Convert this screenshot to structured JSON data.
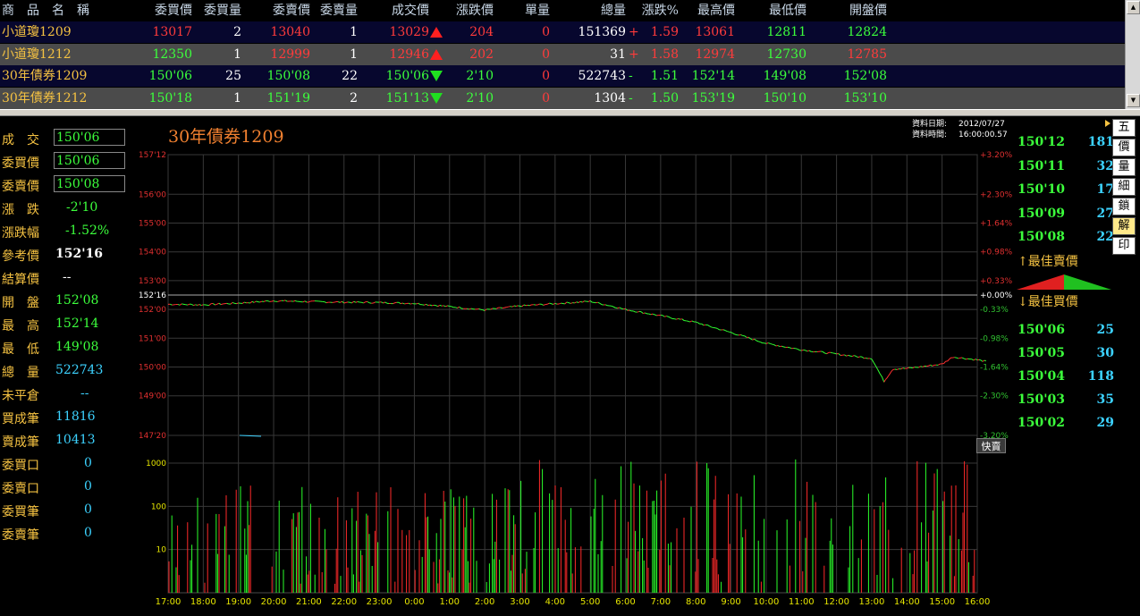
{
  "quote_table": {
    "headers": [
      "商　品　名　稱",
      "委買價",
      "委買量",
      "委賣價",
      "委賣量",
      "成交價",
      "漲跌價",
      "單量",
      "總量",
      "漲跌%",
      "最高價",
      "最低價",
      "開盤價"
    ],
    "rows": [
      {
        "name": "小道瓊1209",
        "bid": "13017",
        "bid_vol": "2",
        "ask": "13040",
        "ask_vol": "1",
        "last": "13029",
        "dir": "up",
        "change": "204",
        "unit_vol": "0",
        "total_vol": "151369",
        "pct_sign": "+",
        "pct": "1.59",
        "high": "13061",
        "low": "12811",
        "open": "12824",
        "name_color": "#f5c242",
        "bid_color": "#ff3b3b",
        "ask_color": "#ff3b3b",
        "last_color": "#ff3b3b",
        "change_color": "#ff3b3b",
        "pct_color": "#ff3b3b",
        "high_color": "#ff3b3b",
        "low_color": "#3cff3c",
        "open_color": "#3cff3c",
        "bg": "#07072e"
      },
      {
        "name": "小道瓊1212",
        "bid": "12350",
        "bid_vol": "1",
        "ask": "12999",
        "ask_vol": "1",
        "last": "12946",
        "dir": "up",
        "change": "202",
        "unit_vol": "0",
        "total_vol": "31",
        "pct_sign": "+",
        "pct": "1.58",
        "high": "12974",
        "low": "12730",
        "open": "12785",
        "name_color": "#f5c242",
        "bid_color": "#3cff3c",
        "ask_color": "#ff3b3b",
        "last_color": "#ff3b3b",
        "change_color": "#ff3b3b",
        "pct_color": "#ff3b3b",
        "high_color": "#ff3b3b",
        "low_color": "#3cff3c",
        "open_color": "#ff3b3b",
        "bg": "#4b4b4b"
      },
      {
        "name": "30年債券1209",
        "bid": "150'06",
        "bid_vol": "25",
        "ask": "150'08",
        "ask_vol": "22",
        "last": "150'06",
        "dir": "down",
        "change": "2'10",
        "unit_vol": "0",
        "total_vol": "522743",
        "pct_sign": "-",
        "pct": "1.51",
        "high": "152'14",
        "low": "149'08",
        "open": "152'08",
        "name_color": "#f5c242",
        "bid_color": "#3cff3c",
        "ask_color": "#3cff3c",
        "last_color": "#3cff3c",
        "change_color": "#3cff3c",
        "pct_color": "#3cff3c",
        "high_color": "#3cff3c",
        "low_color": "#3cff3c",
        "open_color": "#3cff3c",
        "bg": "#07072e"
      },
      {
        "name": "30年債券1212",
        "bid": "150'18",
        "bid_vol": "1",
        "ask": "151'19",
        "ask_vol": "2",
        "last": "151'13",
        "dir": "down",
        "change": "2'10",
        "unit_vol": "0",
        "total_vol": "1304",
        "pct_sign": "-",
        "pct": "1.50",
        "high": "153'19",
        "low": "150'10",
        "open": "153'10",
        "name_color": "#f5c242",
        "bid_color": "#3cff3c",
        "ask_color": "#3cff3c",
        "last_color": "#3cff3c",
        "change_color": "#3cff3c",
        "pct_color": "#3cff3c",
        "high_color": "#3cff3c",
        "low_color": "#3cff3c",
        "open_color": "#3cff3c",
        "bg": "#4b4b4b"
      }
    ]
  },
  "left_panel": {
    "items": [
      {
        "label": "成　交",
        "value": "150'06",
        "color": "#3cff3c",
        "boxed": true
      },
      {
        "label": "委買價",
        "value": "150'06",
        "color": "#3cff3c",
        "boxed": true
      },
      {
        "label": "委賣價",
        "value": "150'08",
        "color": "#3cff3c",
        "boxed": true
      },
      {
        "label": "漲　跌",
        "value": "-2'10",
        "color": "#3cff3c",
        "boxed": false
      },
      {
        "label": "漲跌幅",
        "value": "-1.52%",
        "color": "#3cff3c",
        "boxed": false
      },
      {
        "label": "參考價",
        "value": "152'16",
        "color": "#ffffff",
        "boxed": false
      },
      {
        "label": "結算價",
        "value": "--",
        "color": "#ffffff",
        "boxed": false
      },
      {
        "label": "開　盤",
        "value": "152'08",
        "color": "#3cff3c",
        "boxed": false
      },
      {
        "label": "最　高",
        "value": "152'14",
        "color": "#3cff3c",
        "boxed": false
      },
      {
        "label": "最　低",
        "value": "149'08",
        "color": "#3cff3c",
        "boxed": false
      },
      {
        "label": "總　量",
        "value": "522743",
        "color": "#3cd2ff",
        "boxed": false
      },
      {
        "label": "未平倉",
        "value": "--",
        "color": "#3cd2ff",
        "boxed": false
      },
      {
        "label": "買成筆",
        "value": "11816",
        "color": "#3cd2ff",
        "boxed": false
      },
      {
        "label": "賣成筆",
        "value": "10413",
        "color": "#3cd2ff",
        "boxed": false
      },
      {
        "label": "委買口",
        "value": "0",
        "color": "#3cd2ff",
        "boxed": false
      },
      {
        "label": "委賣口",
        "value": "0",
        "color": "#3cd2ff",
        "boxed": false
      },
      {
        "label": "委買筆",
        "value": "0",
        "color": "#3cd2ff",
        "boxed": false
      },
      {
        "label": "委賣筆",
        "value": "0",
        "color": "#3cd2ff",
        "boxed": false
      }
    ]
  },
  "chart_header": {
    "title": "30年債券1209",
    "date_label": "資料日期:",
    "date_value": "2012/07/27",
    "time_label": "資料時間:",
    "time_value": "16:00:00.57"
  },
  "chart_data": {
    "type": "line",
    "title": "30年債券1209",
    "reference_price": "152'16",
    "price_ticks": [
      "157'12",
      "156'00",
      "155'00",
      "154'00",
      "153'00",
      "152'16",
      "152'00",
      "151'00",
      "150'00",
      "149'00",
      "147'20"
    ],
    "price_tick_values": [
      157.375,
      156.0,
      155.0,
      154.0,
      153.0,
      152.5,
      152.0,
      151.0,
      150.0,
      149.0,
      147.625
    ],
    "pct_ticks": [
      "+3.20%",
      "+2.30%",
      "+1.64%",
      "+0.98%",
      "+0.33%",
      "+0.00%",
      "-0.33%",
      "-0.98%",
      "-1.64%",
      "-2.30%",
      "-3.20%"
    ],
    "ylim": [
      147.625,
      157.375
    ],
    "x": [
      "17:00",
      "18:00",
      "19:00",
      "20:00",
      "21:00",
      "22:00",
      "23:00",
      "0:00",
      "1:00",
      "2:00",
      "3:00",
      "4:00",
      "5:00",
      "6:00",
      "7:00",
      "8:00",
      "9:00",
      "10:00",
      "11:00",
      "12:00",
      "13:00",
      "14:00",
      "15:00",
      "16:00"
    ],
    "price_series": [
      {
        "t": 0,
        "p": 152.18
      },
      {
        "t": 1,
        "p": 152.16
      },
      {
        "t": 2,
        "p": 152.22
      },
      {
        "t": 3,
        "p": 152.3
      },
      {
        "t": 4,
        "p": 152.27
      },
      {
        "t": 5,
        "p": 152.25
      },
      {
        "t": 6,
        "p": 152.24
      },
      {
        "t": 7,
        "p": 152.21
      },
      {
        "t": 8,
        "p": 152.1
      },
      {
        "t": 9,
        "p": 151.98
      },
      {
        "t": 10,
        "p": 152.12
      },
      {
        "t": 11,
        "p": 152.2
      },
      {
        "t": 12,
        "p": 152.28
      },
      {
        "t": 12.6,
        "p": 152.12
      },
      {
        "t": 13,
        "p": 152.0
      },
      {
        "t": 14,
        "p": 151.78
      },
      {
        "t": 15,
        "p": 151.55
      },
      {
        "t": 16,
        "p": 151.2
      },
      {
        "t": 17,
        "p": 150.82
      },
      {
        "t": 18,
        "p": 150.6
      },
      {
        "t": 19,
        "p": 150.45
      },
      {
        "t": 20,
        "p": 150.3
      },
      {
        "t": 20.35,
        "p": 149.5
      },
      {
        "t": 20.6,
        "p": 149.93
      },
      {
        "t": 21,
        "p": 149.95
      },
      {
        "t": 22,
        "p": 150.1
      },
      {
        "t": 22.3,
        "p": 150.35
      },
      {
        "t": 23,
        "p": 150.25
      },
      {
        "t": 23.3,
        "p": 150.18
      }
    ],
    "volume_ticks": [
      "1000",
      "100",
      "10"
    ],
    "volume_tick_values": [
      1000,
      100,
      10
    ],
    "volume_ylim": [
      1,
      3000
    ],
    "volume_scale": "log",
    "grid": true
  },
  "right_panel": {
    "asks": [
      {
        "price": "150'12",
        "vol": "181"
      },
      {
        "price": "150'11",
        "vol": "32"
      },
      {
        "price": "150'10",
        "vol": "17"
      },
      {
        "price": "150'09",
        "vol": "27"
      },
      {
        "price": "150'08",
        "vol": "22"
      }
    ],
    "ask_label": "↑最佳賣價",
    "bid_label": "↓最佳買價",
    "bids": [
      {
        "price": "150'06",
        "vol": "25"
      },
      {
        "price": "150'05",
        "vol": "30"
      },
      {
        "price": "150'04",
        "vol": "118"
      },
      {
        "price": "150'03",
        "vol": "35"
      },
      {
        "price": "150'02",
        "vol": "29"
      }
    ]
  },
  "view_buttons": [
    "五",
    "價",
    "量",
    "細",
    "鎖",
    "解",
    "印"
  ],
  "fast_button": "快賣",
  "colors": {
    "up": "#ff3b3b",
    "down": "#3cff3c",
    "label": "#f5c242",
    "cyan": "#3cd2ff",
    "grid": "#3a3a3a"
  }
}
